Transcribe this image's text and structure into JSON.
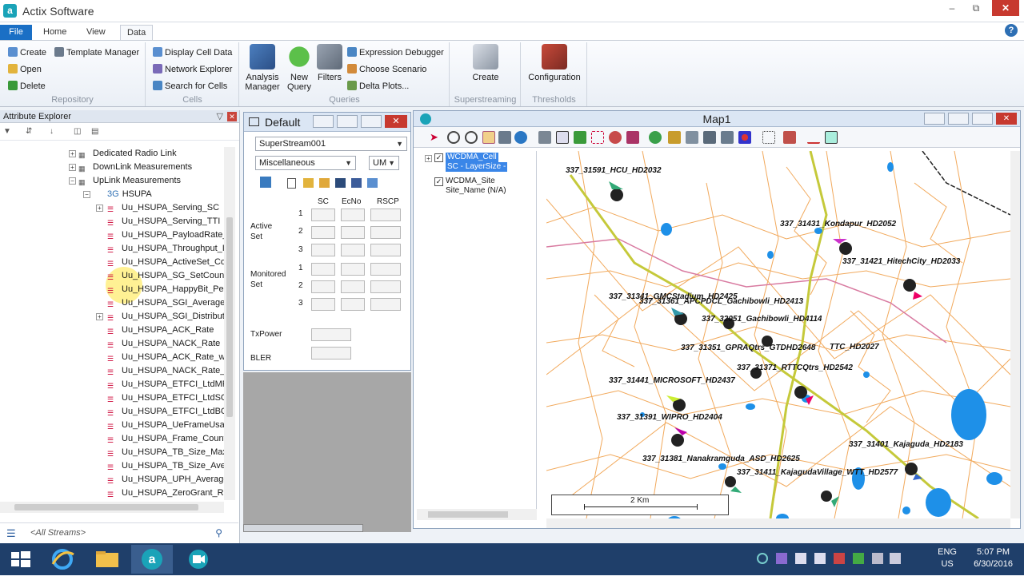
{
  "window": {
    "title": "Actix Software",
    "icon_letter": "a"
  },
  "ribbon_tabs": [
    "File",
    "Home",
    "View",
    "Data"
  ],
  "ribbon": {
    "repository": {
      "label": "Repository",
      "buttons": [
        "Create",
        "Open",
        "Delete"
      ],
      "template_manager": "Template Manager"
    },
    "cells": {
      "label": "Cells",
      "buttons": [
        "Display Cell Data",
        "Network Explorer",
        "Search for Cells"
      ]
    },
    "queries": {
      "label": "Queries",
      "analysis_manager": "Analysis Manager",
      "new_query": "New Query",
      "filters": "Filters",
      "buttons": [
        "Expression Debugger",
        "Choose Scenario",
        "Delta Plots..."
      ]
    },
    "superstreaming": {
      "label": "Superstreaming",
      "create": "Create"
    },
    "thresholds": {
      "label": "Thresholds",
      "configuration": "Configuration"
    }
  },
  "attribute_explorer": {
    "title": "Attribute Explorer",
    "tree": [
      "Dedicated Radio Link",
      "DownLink Measurements",
      "UpLink Measurements",
      "HSUPA",
      "Uu_HSUPA_Serving_SC",
      "Uu_HSUPA_Serving_TTI",
      "Uu_HSUPA_PayloadRate_",
      "Uu_HSUPA_Throughput_I",
      "Uu_HSUPA_ActiveSet_Co",
      "Uu_HSUPA_SG_SetCount",
      "Uu_HSUPA_HappyBit_Per",
      "Uu_HSUPA_SGI_Average",
      "Uu_HSUPA_SGI_Distributi",
      "Uu_HSUPA_ACK_Rate",
      "Uu_HSUPA_NACK_Rate",
      "Uu_HSUPA_ACK_Rate_wit",
      "Uu_HSUPA_NACK_Rate_w",
      "Uu_HSUPA_ETFCI_LtdMP",
      "Uu_HSUPA_ETFCI_LtdSG_",
      "Uu_HSUPA_ETFCI_LtdBO_",
      "Uu_HSUPA_UeFrameUsag",
      "Uu_HSUPA_Frame_Count",
      "Uu_HSUPA_TB_Size_Max",
      "Uu_HSUPA_TB_Size_Avera",
      "Uu_HSUPA_UPH_Average",
      "Uu_HSUPA_ZeroGrant_Ra"
    ],
    "hsupa_prefix": "3G",
    "streams": "<All Streams>"
  },
  "default_panel": {
    "title": "Default",
    "stream_select": "SuperStream001",
    "category_select": "Miscellaneous",
    "um_select": "UM",
    "columns": [
      "SC",
      "EcNo",
      "RSCP"
    ],
    "active_set": "Active Set",
    "monitored_set": "Monitored Set",
    "rows": [
      "1",
      "2",
      "3"
    ],
    "txpower": "TxPower",
    "bler": "BLER"
  },
  "map": {
    "title": "Map1",
    "layers": [
      {
        "name": "WCDMA_Cell",
        "sub": "SC - LayerSize -",
        "checked": true,
        "selected": true
      },
      {
        "name": "WCDMA_Site",
        "sub": "Site_Name (N/A)",
        "checked": true,
        "selected": false
      }
    ],
    "sites": [
      "337_31591_HCU_HD2032",
      "337_31431_Kondapur_HD2052",
      "337_31421_HitechCity_HD2033",
      "337_31341_GMCStadium_HD2425",
      "337_31361_APCPDCL_Gachibowli_HD2413",
      "337_32051_Gachibowli_HD4114",
      "337_31351_GPRAQtrs_GTDHD2648",
      "TTC_HD2027",
      "337_31371_RTTCQtrs_HD2542",
      "337_31441_MICROSOFT_HD2437",
      "337_31391_WIPRO_HD2404",
      "337_31401_Kajaguda_HD2183",
      "337_31381_Nanakramguda_ASD_HD2625",
      "337_31411_KajagudaVillage_WTT_HD2577"
    ],
    "scale": "2 Km"
  },
  "taskbar": {
    "lang_line1": "ENG",
    "lang_line2": "US",
    "time": "5:07 PM",
    "date": "6/30/2016"
  },
  "colors": {
    "accent": "#1a6fc5",
    "road_major": "#c5c93a",
    "road_minor": "#f0a04b",
    "water": "#1e90e8",
    "taskbar": "#1f3f6a"
  }
}
